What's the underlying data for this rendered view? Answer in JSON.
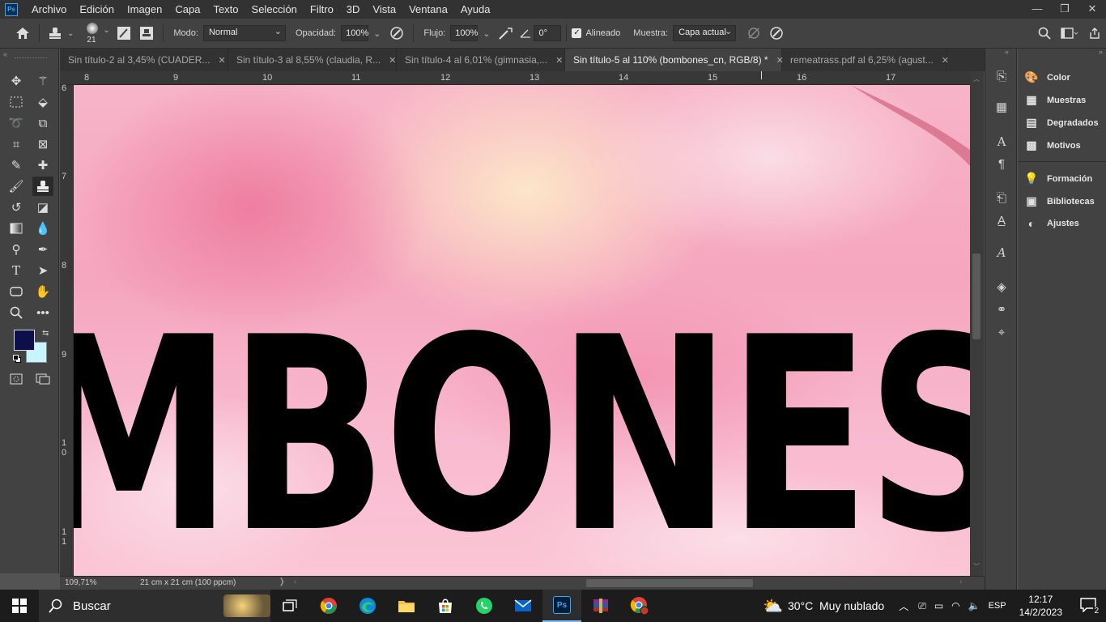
{
  "app": {
    "logo": "Ps"
  },
  "menu": [
    "Archivo",
    "Edición",
    "Imagen",
    "Capa",
    "Texto",
    "Selección",
    "Filtro",
    "3D",
    "Vista",
    "Ventana",
    "Ayuda"
  ],
  "window_controls": {
    "minimize": "—",
    "restore": "❐",
    "close": "✕"
  },
  "options": {
    "brush_size": "21",
    "mode_label": "Modo:",
    "mode_value": "Normal",
    "opacity_label": "Opacidad:",
    "opacity_value": "100%",
    "flow_label": "Flujo:",
    "flow_value": "100%",
    "angle_value": "0°",
    "aligned_label": "Alineado",
    "aligned_checked": true,
    "sample_label": "Muestra:",
    "sample_value": "Capa actual"
  },
  "tabs": [
    {
      "label": "Sin título-2 al 3,45% (CUADER...",
      "active": false
    },
    {
      "label": "Sin título-3 al 8,55% (claudia, R...",
      "active": false
    },
    {
      "label": "Sin título-4 al 6,01% (gimnasia,...",
      "active": false
    },
    {
      "label": "Sin título-5 al 110% (bombones_cn, RGB/8) *",
      "active": true
    },
    {
      "label": "remeatrass.pdf al 6,25% (agust...",
      "active": false
    }
  ],
  "ruler": {
    "top": [
      "8",
      "9",
      "10",
      "11",
      "12",
      "13",
      "14",
      "15",
      "16",
      "17"
    ],
    "left": [
      "6",
      "7",
      "8",
      "9",
      "1\n0",
      "1\n1"
    ]
  },
  "canvas_text": "MBONES_CN",
  "status": {
    "zoom": "109,71%",
    "doc_size": "21 cm x 21 cm (100 ppcm)"
  },
  "panels": [
    {
      "icon": "palette-icon",
      "glyph": "🎨",
      "label": "Color"
    },
    {
      "icon": "grid-icon",
      "glyph": "▦",
      "label": "Muestras"
    },
    {
      "icon": "gradient-icon",
      "glyph": "▤",
      "label": "Degradados"
    },
    {
      "icon": "pattern-icon",
      "glyph": "▩",
      "label": "Motivos"
    },
    {
      "icon": "bulb-icon",
      "glyph": "💡",
      "label": "Formación"
    },
    {
      "icon": "library-icon",
      "glyph": "▣",
      "label": "Bibliotecas"
    },
    {
      "icon": "adjust-icon",
      "glyph": "◐",
      "label": "Ajustes"
    }
  ],
  "colors": {
    "foreground": "#0c0f4a",
    "background": "#c6f4ff",
    "accent": "#31a8ff"
  },
  "taskbar": {
    "search_placeholder": "Buscar",
    "weather": "30°C  Muy nublado",
    "language": "ESP",
    "time": "12:17",
    "date": "14/2/2023",
    "notifications": "2"
  }
}
